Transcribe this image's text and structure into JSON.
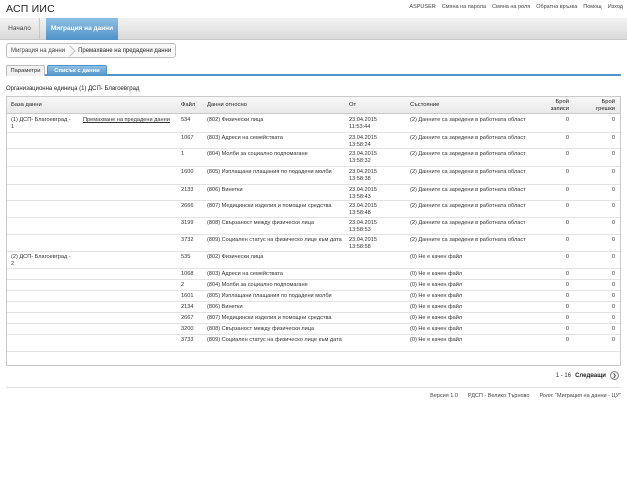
{
  "app": {
    "title": "АСП ИИС"
  },
  "top_links": [
    "ASPUSER",
    "Смяна на парола",
    "Смяна на роля",
    "Обратна връзка",
    "Помощ",
    "Изход"
  ],
  "nav": {
    "home": "Начало",
    "migration": "Миграция на данни"
  },
  "breadcrumb": {
    "parent": "Миграция на данни",
    "current": "Премахване на предадени данни"
  },
  "subtabs": {
    "params": "Параметри",
    "list": "Списък с данни"
  },
  "org_unit": "Организационна единица (1) ДСП- Благоевград",
  "table": {
    "headers": {
      "db": "База данни",
      "file": "Файл",
      "about": "Данни относно",
      "from": "От",
      "state": "Състояние",
      "records": "Брой записи",
      "errors": "Брой грешки"
    },
    "remove_link": "Премахване на предадени данни",
    "rows": [
      {
        "db": "(1) ДСП- Благоевград - 1",
        "link": true,
        "file": "534",
        "about": "(802) Физически лица",
        "date": "23.04.2015",
        "time": "11:53:44",
        "state": "(2) Данните са заредени в работната област",
        "records": "0",
        "errors": "0"
      },
      {
        "db": "",
        "link": false,
        "file": "1067",
        "about": "(803) Адреси на семействата",
        "date": "23.04.2015",
        "time": "13:58:24",
        "state": "(2) Данните са заредени в работната област",
        "records": "0",
        "errors": "0"
      },
      {
        "db": "",
        "link": false,
        "file": "1",
        "about": "(804) Молби за социално подпомагане",
        "date": "23.04.2015",
        "time": "13:58:32",
        "state": "(2) Данните са заредени в работната област",
        "records": "0",
        "errors": "0"
      },
      {
        "db": "",
        "link": false,
        "file": "1600",
        "about": "(805) Изплащани плащания по подадени молби",
        "date": "23.04.2015",
        "time": "13:58:38",
        "state": "(2) Данните са заредени в работната област",
        "records": "0",
        "errors": "0"
      },
      {
        "db": "",
        "link": false,
        "file": "2133",
        "about": "(806) Винетки",
        "date": "23.04.2015",
        "time": "13:58:43",
        "state": "(2) Данните са заредени в работната област",
        "records": "0",
        "errors": "0"
      },
      {
        "db": "",
        "link": false,
        "file": "2666",
        "about": "(807) Медицински изделия и помощни средства",
        "date": "23.04.2015",
        "time": "13:58:48",
        "state": "(2) Данните са заредени в работната област",
        "records": "0",
        "errors": "0"
      },
      {
        "db": "",
        "link": false,
        "file": "3199",
        "about": "(808) Свързаност между физически лица",
        "date": "23.04.2015",
        "time": "13:58:53",
        "state": "(2) Данните са заредени в работната област",
        "records": "0",
        "errors": "0"
      },
      {
        "db": "",
        "link": false,
        "file": "3732",
        "about": "(809) Социален статус на физическо лице към дата",
        "date": "23.04.2015",
        "time": "13:58:58",
        "state": "(2) Данните са заредени в работната област",
        "records": "0",
        "errors": "0"
      },
      {
        "db": "(2) ДСП- Благоевград - 2",
        "link": false,
        "file": "535",
        "about": "(802) Физически лица",
        "date": "",
        "time": "",
        "state": "(0) Не е качен файл",
        "records": "0",
        "errors": "0"
      },
      {
        "db": "",
        "link": false,
        "file": "1068",
        "about": "(803) Адреси на семействата",
        "date": "",
        "time": "",
        "state": "(0) Не е качен файл",
        "records": "0",
        "errors": "0"
      },
      {
        "db": "",
        "link": false,
        "file": "2",
        "about": "(804) Молби за социално подпомагане",
        "date": "",
        "time": "",
        "state": "(0) Не е качен файл",
        "records": "0",
        "errors": "0"
      },
      {
        "db": "",
        "link": false,
        "file": "1601",
        "about": "(805) Изплащани плащания по подадени молби",
        "date": "",
        "time": "",
        "state": "(0) Не е качен файл",
        "records": "0",
        "errors": "0"
      },
      {
        "db": "",
        "link": false,
        "file": "2134",
        "about": "(806) Винетки",
        "date": "",
        "time": "",
        "state": "(0) Не е качен файл",
        "records": "0",
        "errors": "0"
      },
      {
        "db": "",
        "link": false,
        "file": "2667",
        "about": "(807) Медицински изделия и помощни средства",
        "date": "",
        "time": "",
        "state": "(0) Не е качен файл",
        "records": "0",
        "errors": "0"
      },
      {
        "db": "",
        "link": false,
        "file": "3200",
        "about": "(808) Свързаност между физически лица",
        "date": "",
        "time": "",
        "state": "(0) Не е качен файл",
        "records": "0",
        "errors": "0"
      },
      {
        "db": "",
        "link": false,
        "file": "3733",
        "about": "(809) Социален статус на физическо лице към дата",
        "date": "",
        "time": "",
        "state": "(0) Не е качен файл",
        "records": "0",
        "errors": "0"
      }
    ]
  },
  "pager": {
    "range": "1 - 16",
    "next": "Следващи",
    "next_icon": "chevron-right-icon"
  },
  "footer": {
    "version": "Версия 1.0",
    "office": "РДСП - Велико Търново",
    "role": "Роля: \"Миграция на данни - ЦУ\""
  }
}
